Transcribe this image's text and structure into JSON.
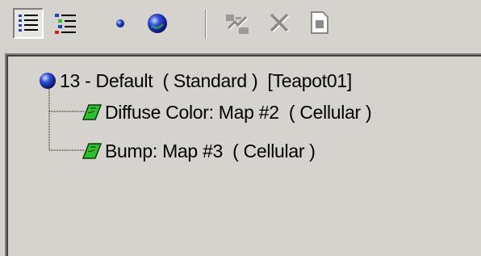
{
  "toolbar": {
    "buttons": [
      {
        "icon": "display-tree-icon",
        "pressed": true
      },
      {
        "icon": "display-tree-colored-icon",
        "pressed": false
      },
      {
        "icon": "small-sphere-icon",
        "pressed": false
      },
      {
        "icon": "large-sphere-icon",
        "pressed": false
      },
      {
        "icon": "pick-material-icon",
        "disabled": true
      },
      {
        "icon": "delete-icon",
        "disabled": true
      },
      {
        "icon": "document-icon",
        "disabled": true
      }
    ]
  },
  "tree": {
    "root": {
      "label": "13 - Default  ( Standard )  [Teapot01]",
      "icon": "material-sphere-icon"
    },
    "children": [
      {
        "label": "Diffuse Color: Map #2  ( Cellular )",
        "icon": "map-parallelogram-icon"
      },
      {
        "label": "Bump: Map #3  ( Cellular )",
        "icon": "map-parallelogram-icon"
      }
    ]
  },
  "colors": {
    "background": "#d6d3ce",
    "map_icon": "#2fbf2f",
    "sphere": "#1f3fc8"
  }
}
